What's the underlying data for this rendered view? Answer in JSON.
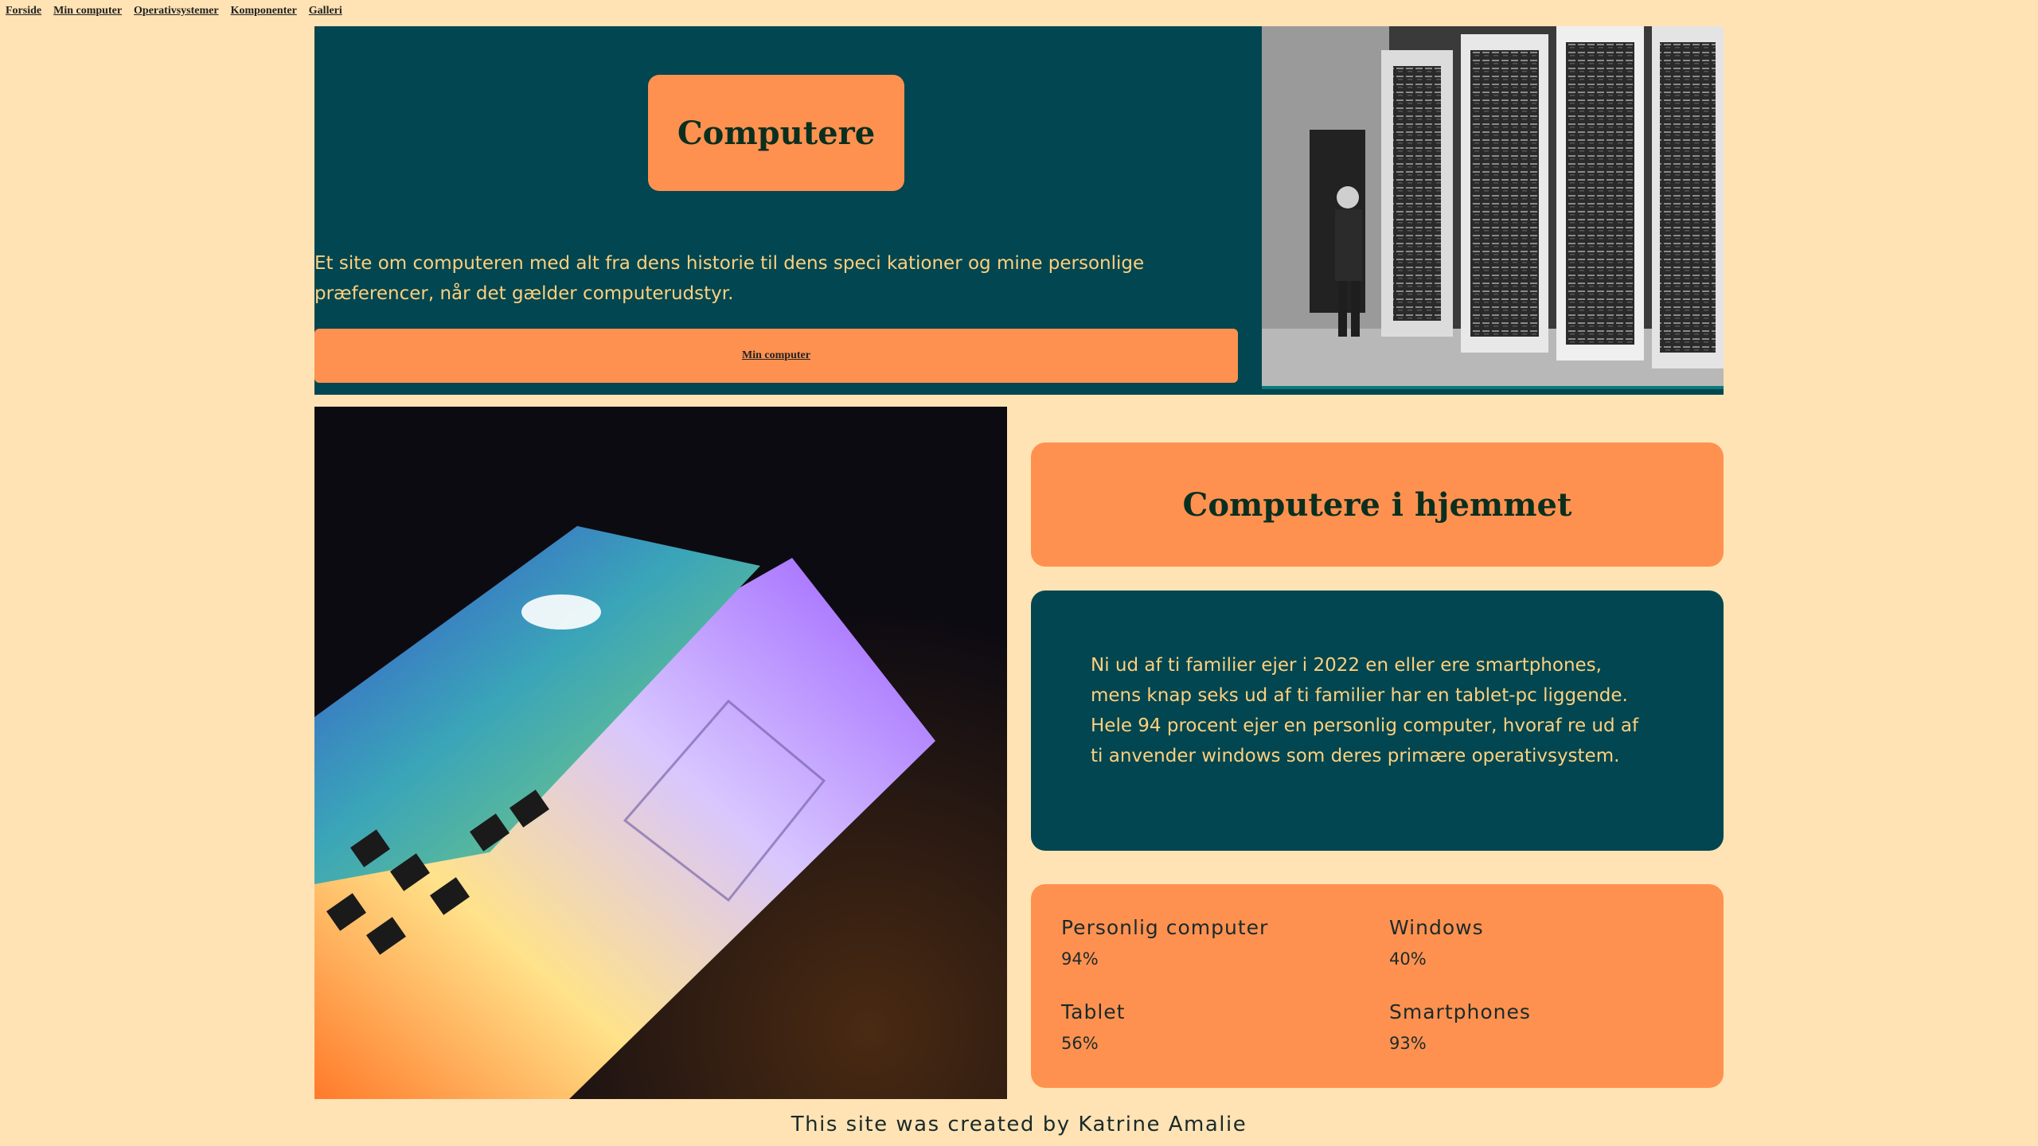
{
  "nav": {
    "items": [
      {
        "label": "Forside"
      },
      {
        "label": "Min computer"
      },
      {
        "label": "Operativsystemer"
      },
      {
        "label": "Komponenter"
      },
      {
        "label": "Galleri"
      }
    ]
  },
  "hero": {
    "title": "Computere",
    "text": "Et site om computeren med alt fra dens historie til dens speci  kationer og mine personlige præferencer, når det gælder computerudstyr.",
    "button_label": "Min computer"
  },
  "home": {
    "heading": "Computere i hjemmet",
    "text": "Ni ud af ti familier ejer i 2022 en eller   ere smartphones, mens knap seks ud af ti familier har en tablet-pc liggende. Hele 94 procent ejer en personlig computer, hvoraf   re ud af ti anvender windows som deres primære operativsystem."
  },
  "stats": [
    {
      "label": "Personlig computer",
      "value": "94%"
    },
    {
      "label": "Windows",
      "value": "40%"
    },
    {
      "label": "Tablet",
      "value": "56%"
    },
    {
      "label": "Smartphones",
      "value": "93%"
    }
  ],
  "footer": {
    "text": "This site was created by Katrine Amalie"
  },
  "colors": {
    "background": "#ffe3b4",
    "teal": "#014650",
    "orange": "#ff9150",
    "yellow_text": "#ffd07e",
    "dark_green_text": "#0b2f1e"
  }
}
